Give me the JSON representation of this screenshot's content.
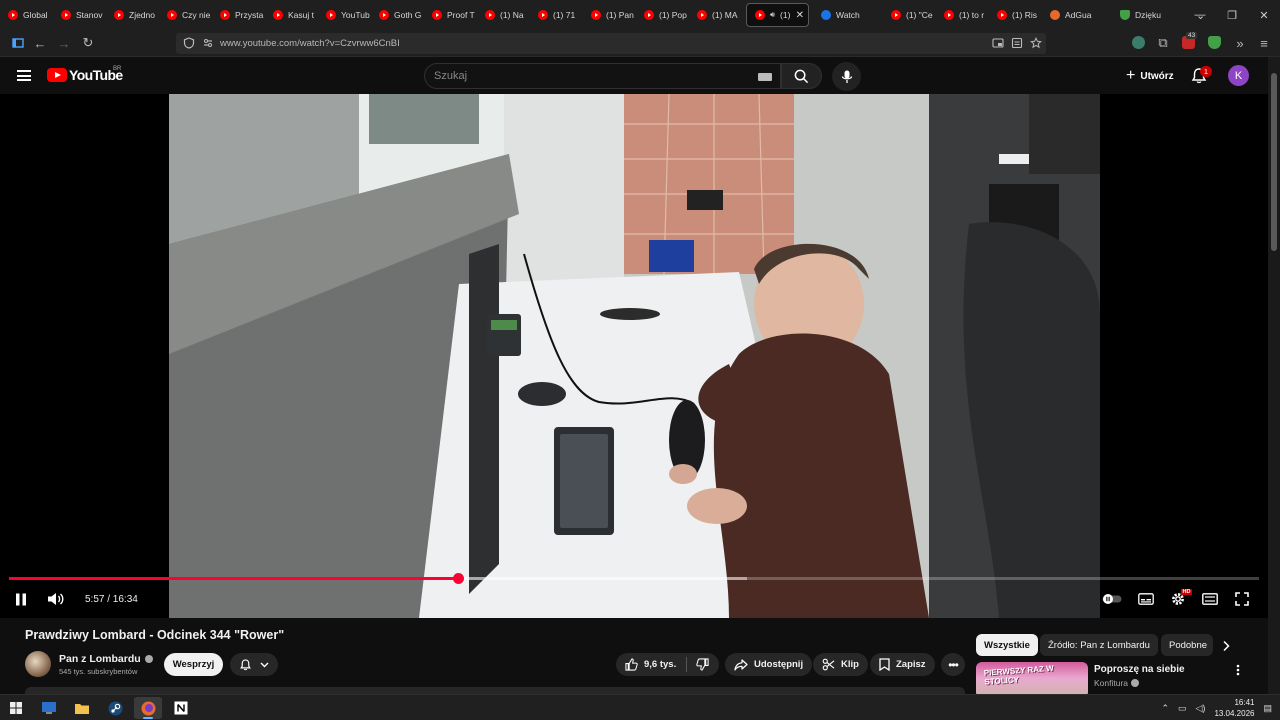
{
  "browser": {
    "tabs": [
      {
        "label": "Global",
        "icon": "youtube-favicon"
      },
      {
        "label": "Stanov",
        "icon": "youtube-favicon"
      },
      {
        "label": "Zjedno",
        "icon": "youtube-favicon"
      },
      {
        "label": "Czy nie",
        "icon": "youtube-favicon"
      },
      {
        "label": "Przysta",
        "icon": "youtube-favicon"
      },
      {
        "label": "Kasuj t",
        "icon": "youtube-favicon"
      },
      {
        "label": "YouTub",
        "icon": "youtube-favicon"
      },
      {
        "label": "Goth G",
        "icon": "youtube-favicon"
      },
      {
        "label": "Proof T",
        "icon": "youtube-favicon"
      },
      {
        "label": "(1) Na",
        "icon": "youtube-favicon"
      },
      {
        "label": "(1) 71",
        "icon": "youtube-favicon"
      },
      {
        "label": "(1) Pan",
        "icon": "youtube-favicon"
      },
      {
        "label": "(1) Pop",
        "icon": "youtube-favicon"
      },
      {
        "label": "(1) MA",
        "icon": "youtube-favicon"
      },
      {
        "label": "(1)",
        "icon": "youtube-favicon",
        "active": true
      },
      {
        "label": "Watch",
        "icon": "watch-favicon"
      },
      {
        "label": "(1) \"Ce",
        "icon": "youtube-favicon"
      },
      {
        "label": "(1) to r",
        "icon": "youtube-favicon"
      },
      {
        "label": "(1) Ris",
        "icon": "youtube-favicon"
      },
      {
        "label": "AdGua",
        "icon": "adguard-favicon"
      },
      {
        "label": "Dzięku",
        "icon": "shield-favicon"
      }
    ],
    "url": "www.youtube.com/watch?v=Czvrww6CnBI",
    "extension_badge": "43"
  },
  "header": {
    "logo_text": "YouTube",
    "region": "BR",
    "search_placeholder": "Szukaj",
    "create_label": "Utwórz",
    "notification_count": "1",
    "avatar_letter": "K",
    "avatar_color": "#8e44c4"
  },
  "player": {
    "current_time": "5:57",
    "duration": "16:34",
    "time_display": "5:57 / 16:34",
    "played_fraction": 0.359,
    "buffered_fraction": 0.59,
    "settings_badge": "HD",
    "accent_color": "#ff0033"
  },
  "video": {
    "title": "Prawdziwy Lombard - Odcinek 344 \"Rower\"",
    "channel_name": "Pan z Lombardu",
    "subscribers": "545 tys. subskrybentów",
    "support_label": "Wesprzyj",
    "likes": "9,6 tys.",
    "share_label": "Udostępnij",
    "clip_label": "Klip",
    "save_label": "Zapisz"
  },
  "sidebar": {
    "chips": [
      "Wszystkie",
      "Źródło: Pan z Lombardu",
      "Podobne"
    ],
    "active_chip": "Wszystkie",
    "recommendation": {
      "thumb_text": "PIERWSZY RAZ W STOLICY",
      "title": "Poproszę na siebie",
      "channel": "Konfitura"
    }
  },
  "taskbar": {
    "apps": [
      "windows-start",
      "explorer",
      "file-manager",
      "steam",
      "firefox",
      "notion"
    ],
    "time": "16:41",
    "date": "13.04.2026"
  }
}
